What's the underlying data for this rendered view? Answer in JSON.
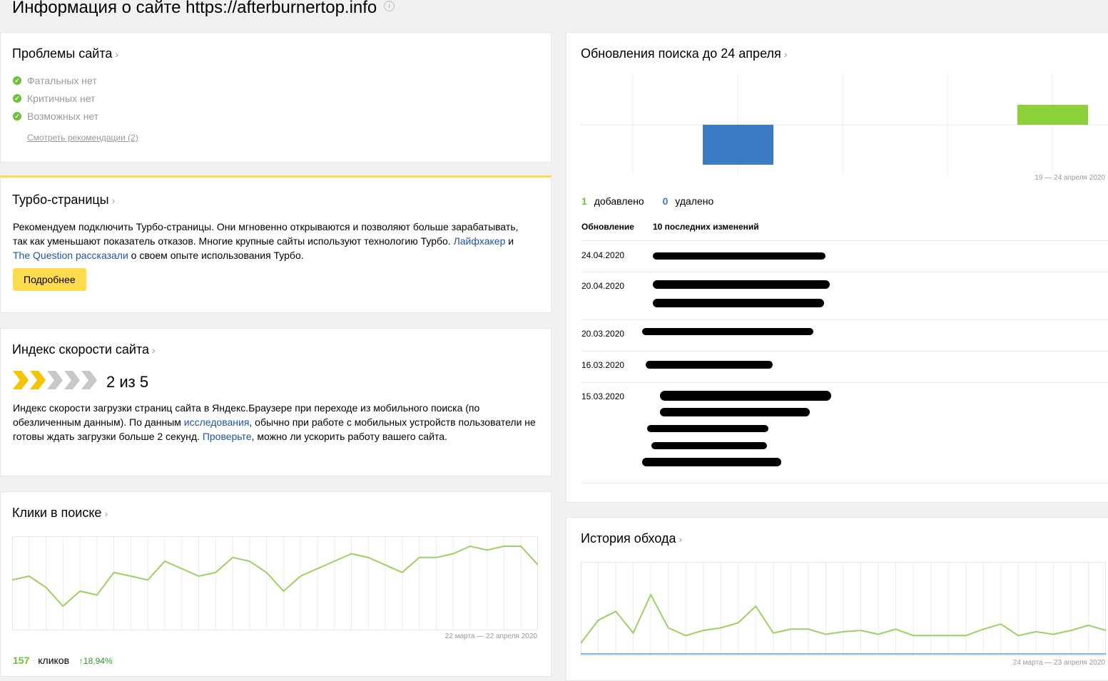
{
  "page": {
    "title": "Информация о сайте https://afterburnertop.info",
    "info_glyph": "i"
  },
  "problems": {
    "title": "Проблемы сайта",
    "items": [
      "Фатальных нет",
      "Критичных нет",
      "Возможных нет"
    ],
    "recommendations_link": "Смотреть рекомендации (2)"
  },
  "turbo": {
    "title": "Турбо-страницы",
    "text_part1": "Рекомендуем подключить Турбо-страницы. Они мгновенно открываются и позволяют больше зарабатывать, так как уменьшают показатель отказов. Многие крупные сайты используют технологию Турбо.",
    "link1": "Лайфхакер",
    "and": "и",
    "link2": "The Question рассказали",
    "text_part2": "о своем опыте использования Турбо.",
    "button": "Подробнее",
    "accent_color": "#ffdb4d"
  },
  "speed": {
    "title": "Индекс скорости сайта",
    "score": "2 из 5",
    "score_value": 2,
    "score_max": 5,
    "text_part1": "Индекс скорости загрузки страниц сайта в Яндекс.Браузере при переходе из мобильного поиска (по обезличенным данным). По данным",
    "link1": "исследования",
    "text_part2": ", обычно при работе с мобильных устройств пользователи не готовы ждать загрузки больше 2 секунд.",
    "link2": "Проверьте",
    "text_part3": ", можно ли ускорить работу вашего сайта."
  },
  "clicks": {
    "title": "Клики в поиске",
    "range": "22 марта — 22 апреля 2020",
    "count": "157",
    "count_label": "кликов",
    "change": "↑18,94%",
    "line_color": "#9ccf64"
  },
  "search_updates": {
    "title": "Обновления поиска до 24 апреля",
    "range": "19 — 24 апреля 2020",
    "added_count": "1",
    "added_label": "добавлено",
    "removed_count": "0",
    "removed_label": "удалено",
    "col_update": "Обновление",
    "col_changes": "10 последних изменений",
    "rows": [
      {
        "date": "24.04.2020"
      },
      {
        "date": "20.04.2020"
      },
      {
        "date": "20.03.2020"
      },
      {
        "date": "16.03.2020"
      },
      {
        "date": "15.03.2020"
      }
    ],
    "added_color": "#8cd03a",
    "removed_color": "#3a7bc4"
  },
  "crawl_history": {
    "title": "История обхода",
    "range": "24 марта — 23 апреля 2020",
    "line_color": "#9ccf64"
  },
  "chart_data": [
    {
      "type": "line",
      "title": "Клики в поиске",
      "series": [
        {
          "values": [
            8,
            9,
            6,
            1,
            5,
            4,
            10,
            9,
            8,
            13,
            11,
            9,
            10,
            14,
            13,
            10,
            5,
            9,
            11,
            13,
            15,
            14,
            12,
            10,
            14,
            14,
            15,
            17,
            16,
            17,
            17,
            12
          ]
        }
      ]
    },
    {
      "type": "bar",
      "title": "Обновления поиска до 24 апреля",
      "categories": [
        "1",
        "2",
        "3",
        "4",
        "5"
      ],
      "series": [
        {
          "name": "добавлено",
          "values": [
            0,
            0,
            0,
            0,
            1
          ]
        },
        {
          "name": "удалено",
          "values": [
            0,
            -2,
            0,
            0,
            0
          ]
        }
      ]
    },
    {
      "type": "line",
      "title": "История обхода",
      "series": [
        {
          "values": [
            2,
            20,
            27,
            10,
            40,
            14,
            8,
            12,
            14,
            18,
            31,
            10,
            13,
            13,
            9,
            11,
            12,
            9,
            13,
            8,
            8,
            8,
            8,
            13,
            17,
            8,
            11,
            9,
            12,
            16,
            12
          ]
        }
      ]
    }
  ]
}
